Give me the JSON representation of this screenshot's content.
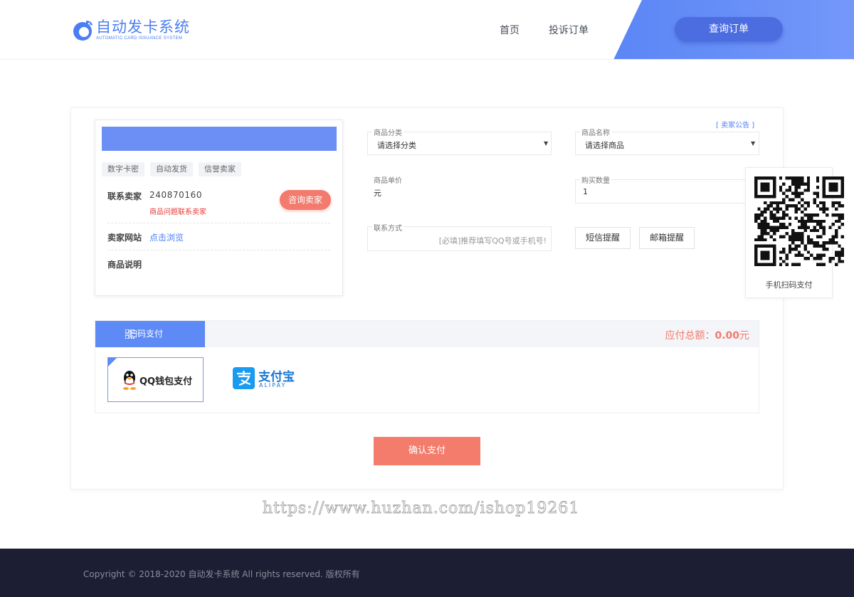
{
  "header": {
    "logo_title": "自动发卡系统",
    "logo_subtitle": "AUTOMATIC CARD ISSUANCE SYSTEM",
    "nav": [
      {
        "label": "首页"
      },
      {
        "label": "投诉订单"
      }
    ],
    "query_button": "查询订单"
  },
  "seller": {
    "tags": [
      "数字卡密",
      "自动发货",
      "信誉卖家"
    ],
    "contact_label": "联系卖家",
    "contact_qq": "240870160",
    "contact_note": "商品问题联系卖家",
    "consult_button": "咨询卖家",
    "website_label": "卖家网站",
    "website_link": "点击浏览",
    "description_label": "商品说明"
  },
  "form": {
    "notice_link": "[ 卖家公告 ]",
    "category": {
      "label": "商品分类",
      "value": "请选择分类"
    },
    "product": {
      "label": "商品名称",
      "value": "请选择商品"
    },
    "unit_price": {
      "label": "商品单价",
      "value": "元"
    },
    "quantity": {
      "label": "购买数量",
      "value": "1"
    },
    "contact": {
      "label": "联系方式",
      "placeholder": "[必填]推荐填写QQ号或手机号!"
    },
    "sms_button": "短信提醒",
    "email_button": "邮箱提醒"
  },
  "qr": {
    "caption": "手机扫码支付"
  },
  "payment": {
    "tab_label": "扫码支付",
    "total_label": "应付总额：",
    "total_value": "0.00",
    "total_unit": "元",
    "methods": [
      {
        "label": "QQ钱包支付",
        "selected": true
      },
      {
        "label": "支付宝",
        "sublabel": "ALIPAY",
        "selected": false
      }
    ],
    "confirm_button": "确认支付"
  },
  "watermark": "https://www.huzhan.com/ishop19261",
  "footer": {
    "copyright": "Copyright © 2018-2020 自动发卡系统 All rights reserved. 版权所有"
  },
  "colors": {
    "brand_blue": "#4b7ef3",
    "accent_coral": "#f27b6d",
    "footer_bg": "#1c1e33"
  }
}
